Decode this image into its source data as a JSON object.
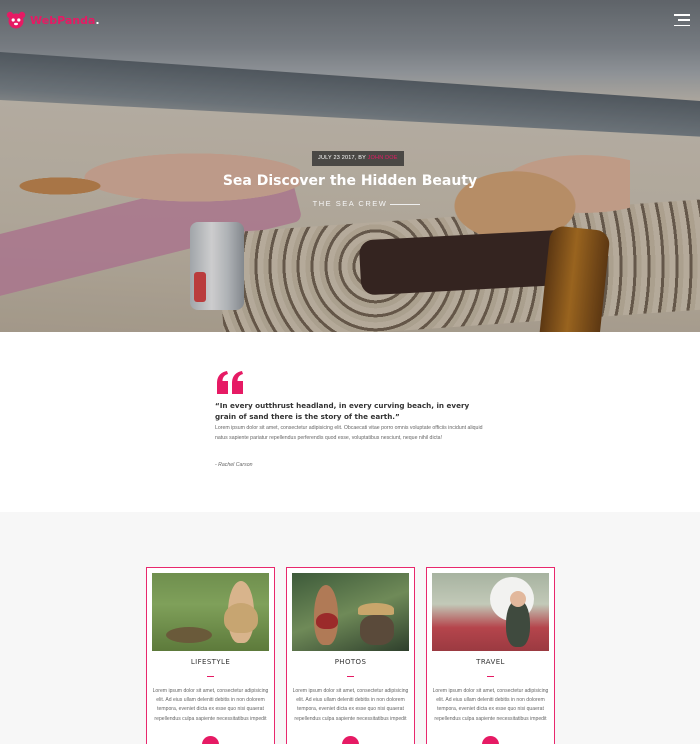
{
  "brand": {
    "name": "WebPanda",
    "dot": ".",
    "accent": "#e61a64"
  },
  "hero": {
    "date": "JULY 23 2017, BY",
    "author": "JOHN DOE",
    "title": "Sea Discover the Hidden Beauty",
    "subtitle": "THE SEA CREW"
  },
  "quote": {
    "text": "“In every outthrust headland, in every curving beach, in every grain of sand there is the story of the earth.”",
    "body": "Lorem ipsum dolor sit amet, consectetur adipisicing elit. Obcaecati vitae porro omnis voluptate officiis incidunt aliquid natus sapiente pariatur repellendus perferendis quod esse, voluptatibus nesciunt, neque nihil dicta!",
    "author": "- Rachel Carson"
  },
  "cards": [
    {
      "title": "LIFESTYLE",
      "text": "Lorem ipsum dolor sit amet, consectetur adipisicing elit. Ad eius ullam deleniti debitis in non dolorem tempora, eveniet dicta ex esse quo nisi quaerat repellendus culpa sapiente necessitatibus impedit"
    },
    {
      "title": "PHOTOS",
      "text": "Lorem ipsum dolor sit amet, consectetur adipisicing elit. Ad eius ullam deleniti debitis in non dolorem tempora, eveniet dicta ex esse quo nisi quaerat repellendus culpa sapiente necessitatibus impedit"
    },
    {
      "title": "TRAVEL",
      "text": "Lorem ipsum dolor sit amet, consectetur adipisicing elit. Ad eius ullam deleniti debitis in non dolorem tempora, eveniet dicta ex esse quo nisi quaerat repellendus culpa sapiente necessitatibus impedit"
    }
  ],
  "icons": {
    "logo": "panda-logo-icon",
    "menu": "hamburger-menu-icon",
    "quote": "quote-mark-icon",
    "card_button": "circle-button"
  }
}
